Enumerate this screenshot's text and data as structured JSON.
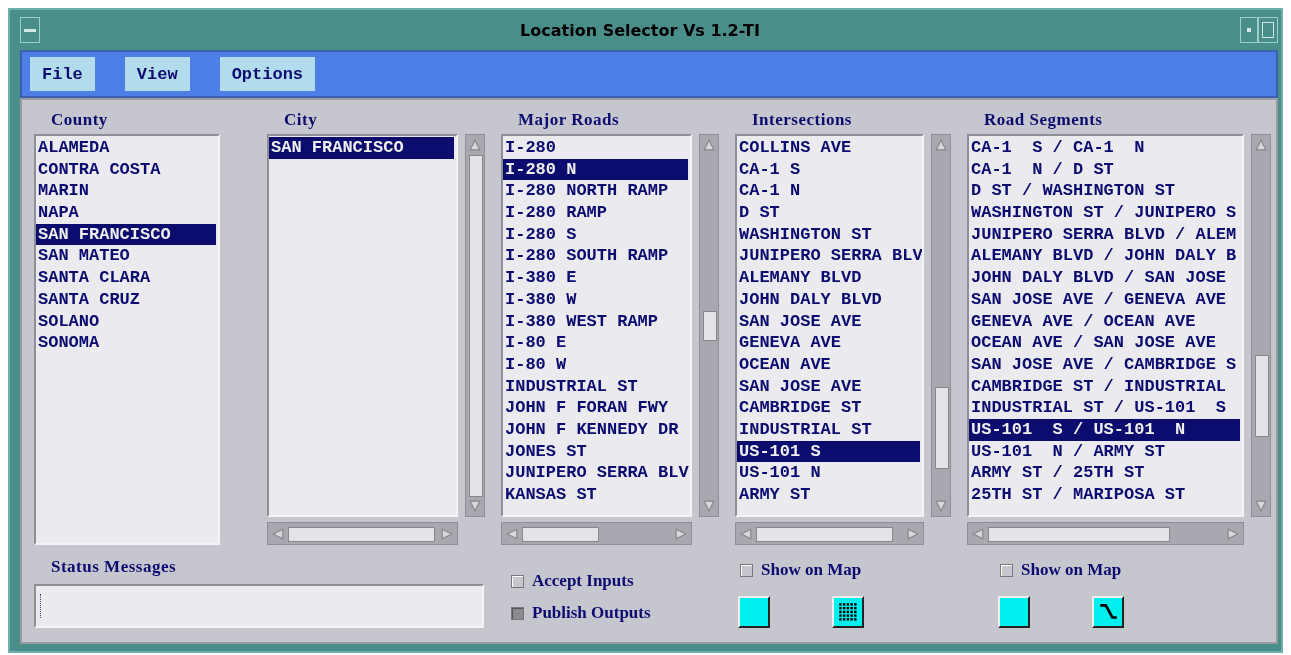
{
  "window": {
    "title": "Location Selector Vs 1.2-TI"
  },
  "menu": [
    "File",
    "View",
    "Options"
  ],
  "lists": [
    {
      "heading": "County",
      "kind": "plain",
      "items": [
        {
          "text": "ALAMEDA",
          "selected": false
        },
        {
          "text": "CONTRA COSTA",
          "selected": false
        },
        {
          "text": "MARIN",
          "selected": false
        },
        {
          "text": "NAPA",
          "selected": false
        },
        {
          "text": "SAN FRANCISCO",
          "selected": true
        },
        {
          "text": "SAN MATEO",
          "selected": false
        },
        {
          "text": "SANTA CLARA",
          "selected": false
        },
        {
          "text": "SANTA CRUZ",
          "selected": false
        },
        {
          "text": "SOLANO",
          "selected": false
        },
        {
          "text": "SONOMA",
          "selected": false
        }
      ]
    },
    {
      "heading": "City",
      "kind": "scrolled",
      "items": [
        {
          "text": "SAN FRANCISCO",
          "selected": true
        }
      ]
    },
    {
      "heading": "Major Roads",
      "kind": "scrolled",
      "items": [
        {
          "text": "I-280",
          "selected": false
        },
        {
          "text": "I-280 N",
          "selected": true
        },
        {
          "text": "I-280 NORTH RAMP",
          "selected": false
        },
        {
          "text": "I-280 RAMP",
          "selected": false
        },
        {
          "text": "I-280 S",
          "selected": false
        },
        {
          "text": "I-280 SOUTH RAMP",
          "selected": false
        },
        {
          "text": "I-380 E",
          "selected": false
        },
        {
          "text": "I-380 W",
          "selected": false
        },
        {
          "text": "I-380 WEST RAMP",
          "selected": false
        },
        {
          "text": "I-80 E",
          "selected": false
        },
        {
          "text": "I-80 W",
          "selected": false
        },
        {
          "text": "INDUSTRIAL ST",
          "selected": false
        },
        {
          "text": "JOHN F FORAN FWY",
          "selected": false
        },
        {
          "text": "JOHN F KENNEDY DR",
          "selected": false
        },
        {
          "text": "JONES ST",
          "selected": false
        },
        {
          "text": "JUNIPERO SERRA BLV",
          "selected": false
        },
        {
          "text": "KANSAS ST",
          "selected": false
        }
      ]
    },
    {
      "heading": "Intersections",
      "kind": "scrolled",
      "items": [
        {
          "text": "COLLINS AVE",
          "selected": false
        },
        {
          "text": "CA-1 S",
          "selected": false
        },
        {
          "text": "CA-1 N",
          "selected": false
        },
        {
          "text": "D ST",
          "selected": false
        },
        {
          "text": "WASHINGTON ST",
          "selected": false
        },
        {
          "text": "JUNIPERO SERRA BLV",
          "selected": false
        },
        {
          "text": "ALEMANY BLVD",
          "selected": false
        },
        {
          "text": "JOHN DALY BLVD",
          "selected": false
        },
        {
          "text": "SAN JOSE AVE",
          "selected": false
        },
        {
          "text": "GENEVA AVE",
          "selected": false
        },
        {
          "text": "OCEAN AVE",
          "selected": false
        },
        {
          "text": "SAN JOSE AVE",
          "selected": false
        },
        {
          "text": "CAMBRIDGE ST",
          "selected": false
        },
        {
          "text": "INDUSTRIAL ST",
          "selected": false
        },
        {
          "text": "US-101 S",
          "selected": true
        },
        {
          "text": "US-101 N",
          "selected": false
        },
        {
          "text": "ARMY ST",
          "selected": false
        }
      ]
    },
    {
      "heading": "Road Segments",
      "kind": "scrolled",
      "items": [
        {
          "text": "CA-1  S / CA-1  N",
          "selected": false
        },
        {
          "text": "CA-1  N / D ST",
          "selected": false
        },
        {
          "text": "D ST / WASHINGTON ST",
          "selected": false
        },
        {
          "text": "WASHINGTON ST / JUNIPERO S",
          "selected": false
        },
        {
          "text": "JUNIPERO SERRA BLVD / ALEM",
          "selected": false
        },
        {
          "text": "ALEMANY BLVD / JOHN DALY B",
          "selected": false
        },
        {
          "text": "JOHN DALY BLVD / SAN JOSE",
          "selected": false
        },
        {
          "text": "SAN JOSE AVE / GENEVA AVE",
          "selected": false
        },
        {
          "text": "GENEVA AVE / OCEAN AVE",
          "selected": false
        },
        {
          "text": "OCEAN AVE / SAN JOSE AVE",
          "selected": false
        },
        {
          "text": "SAN JOSE AVE / CAMBRIDGE S",
          "selected": false
        },
        {
          "text": "CAMBRIDGE ST / INDUSTRIAL",
          "selected": false
        },
        {
          "text": "INDUSTRIAL ST / US-101  S",
          "selected": false
        },
        {
          "text": "US-101  S / US-101  N",
          "selected": true
        },
        {
          "text": "US-101  N / ARMY ST",
          "selected": false
        },
        {
          "text": "ARMY ST / 25TH ST",
          "selected": false
        },
        {
          "text": "25TH ST / MARIPOSA ST",
          "selected": false
        }
      ]
    }
  ],
  "status": {
    "label": "Status Messages"
  },
  "options": [
    {
      "label": "Accept Inputs",
      "checked": false
    },
    {
      "label": "Publish Outputs",
      "checked": true
    }
  ],
  "map_groups": [
    {
      "label": "Show on Map",
      "checked": false,
      "kind": "grid"
    },
    {
      "label": "Show on Map",
      "checked": false,
      "kind": "curve"
    }
  ]
}
